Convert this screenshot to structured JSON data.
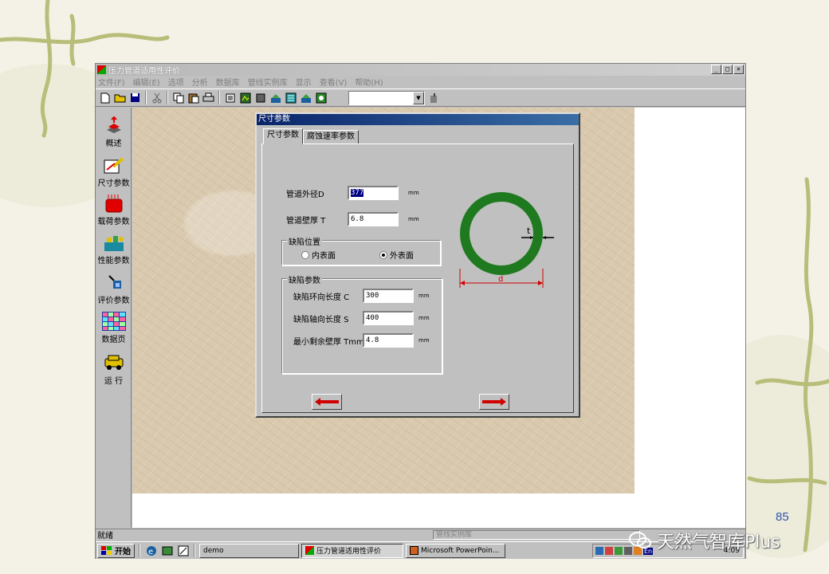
{
  "window": {
    "title": "压力管道适用性评价",
    "controls": [
      "_",
      "□",
      "×"
    ]
  },
  "menu": [
    "文件(F)",
    "编辑(E)",
    "选项",
    "分析",
    "数据库",
    "管线实例库",
    "显示",
    "查看(V)",
    "帮助(H)"
  ],
  "toolbar": {
    "icons": [
      "new-icon",
      "open-icon",
      "save-icon",
      "cut-icon",
      "copy-icon",
      "paste-icon",
      "print-icon",
      "tool-1-icon",
      "tool-2-icon",
      "tool-3-icon",
      "tool-4-icon",
      "tool-5-icon",
      "tool-6-icon"
    ],
    "combo_value": ""
  },
  "sidebar": {
    "items": [
      {
        "label": "概述",
        "icon": "overview-icon"
      },
      {
        "label": "尺寸参数",
        "icon": "dimension-icon"
      },
      {
        "label": "载荷参数",
        "icon": "load-icon"
      },
      {
        "label": "性能参数",
        "icon": "performance-icon"
      },
      {
        "label": "评价参数",
        "icon": "evaluation-icon"
      },
      {
        "label": "数据页",
        "icon": "data-page-icon"
      },
      {
        "label": "运  行",
        "icon": "run-icon"
      }
    ]
  },
  "dialog": {
    "title": "尺寸参数",
    "tabs": [
      "尺寸参数",
      "腐蚀速率参数"
    ],
    "outer_diameter": {
      "label": "管道外径D",
      "value": "377",
      "unit": "mm"
    },
    "wall_thickness": {
      "label": "管道壁厚 T",
      "value": "6.8",
      "unit": "mm"
    },
    "defect_location": {
      "title": "缺陷位置",
      "options": [
        "内表面",
        "外表面"
      ],
      "selected": "外表面"
    },
    "defect_params": {
      "title": "缺陷参数",
      "fields": [
        {
          "label": "缺陷环向长度 C",
          "value": "300",
          "unit": "mm"
        },
        {
          "label": "缺陷轴向长度 S",
          "value": "400",
          "unit": "mm"
        },
        {
          "label": "最小剩余壁厚 Tmm",
          "value": "4.8",
          "unit": "mm"
        }
      ]
    },
    "diagram": {
      "thickness_label": "t",
      "diameter_label": "d",
      "ring_color": "#1f7a1f",
      "dim_color": "#d00000"
    }
  },
  "status": {
    "left": "就绪",
    "right": "管线实例库"
  },
  "taskbar": {
    "start": "开始",
    "tasks": [
      "demo",
      "压力管道适用性评价",
      "Microsoft PowerPoin..."
    ],
    "clock": "4:09",
    "lang": "En"
  },
  "slide": {
    "page_number": "85",
    "watermark": "天然气智库Plus"
  }
}
